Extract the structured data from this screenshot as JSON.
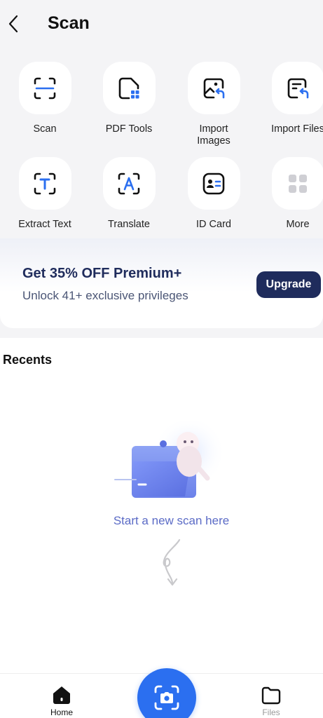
{
  "header": {
    "title": "Scan"
  },
  "tools": [
    {
      "label": "Scan",
      "icon": "scan-frame-icon"
    },
    {
      "label": "PDF Tools",
      "icon": "pdf-tools-icon"
    },
    {
      "label": "Import\nImages",
      "icon": "import-images-icon"
    },
    {
      "label": "Import Files",
      "icon": "import-files-icon"
    },
    {
      "label": "Extract Text",
      "icon": "extract-text-icon"
    },
    {
      "label": "Translate",
      "icon": "translate-icon"
    },
    {
      "label": "ID Card",
      "icon": "id-card-icon"
    },
    {
      "label": "More",
      "icon": "more-grid-icon"
    }
  ],
  "promo": {
    "title": "Get 35% OFF Premium+",
    "subtitle": "Unlock 41+ exclusive privileges",
    "button": "Upgrade"
  },
  "recents": {
    "title": "Recents",
    "empty_text": "Start a new scan here"
  },
  "nav": {
    "home": "Home",
    "files": "Files"
  },
  "colors": {
    "accent_blue": "#2b6ff0",
    "promo_navy": "#1f2c5c",
    "empty_text": "#5b6bc6"
  }
}
